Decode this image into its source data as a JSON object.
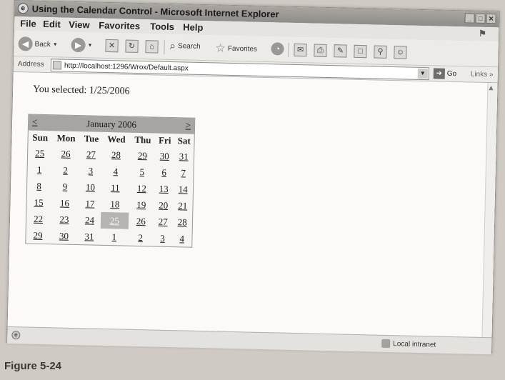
{
  "window": {
    "title": "Using the Calendar Control - Microsoft Internet Explorer",
    "buttons": [
      "_",
      "□",
      "✕"
    ]
  },
  "menu": {
    "items": [
      "File",
      "Edit",
      "View",
      "Favorites",
      "Tools",
      "Help"
    ]
  },
  "toolbar": {
    "back_label": "Back",
    "search_label": "Search",
    "favorites_label": "Favorites"
  },
  "address": {
    "label": "Address",
    "url": "http://localhost:1296/Wrox/Default.aspx",
    "go_label": "Go",
    "links_label": "Links »"
  },
  "content": {
    "selected_text": "You selected: 1/25/2006"
  },
  "calendar": {
    "prev": "<",
    "month": "January 2006",
    "next": ">",
    "day_headers": [
      "Sun",
      "Mon",
      "Tue",
      "Wed",
      "Thu",
      "Fri",
      "Sat"
    ],
    "weeks": [
      [
        "25",
        "26",
        "27",
        "28",
        "29",
        "30",
        "31"
      ],
      [
        "1",
        "2",
        "3",
        "4",
        "5",
        "6",
        "7"
      ],
      [
        "8",
        "9",
        "10",
        "11",
        "12",
        "13",
        "14"
      ],
      [
        "15",
        "16",
        "17",
        "18",
        "19",
        "20",
        "21"
      ],
      [
        "22",
        "23",
        "24",
        "25",
        "26",
        "27",
        "28"
      ],
      [
        "29",
        "30",
        "31",
        "1",
        "2",
        "3",
        "4"
      ]
    ],
    "selected_date": "25"
  },
  "status": {
    "zone": "Local intranet"
  },
  "caption": "Figure 5-24",
  "colors": {
    "titlebar": "#9a9894",
    "calendar_title": "#a7a5a1",
    "selected_day": "#b6b4b0"
  }
}
